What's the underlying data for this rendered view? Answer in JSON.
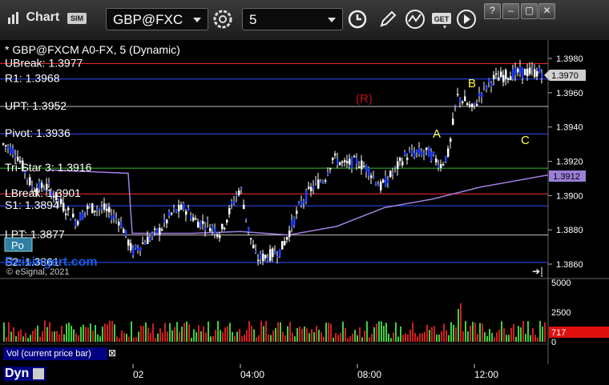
{
  "window": {
    "title": "Chart",
    "sim_badge": "SIM",
    "symbol": "GBP@FXC",
    "interval": "5",
    "buttons": [
      "settings-icon",
      "clock-icon",
      "pencil-icon",
      "study-icon",
      "get-icon",
      "play-icon",
      "help-icon",
      "minimize-icon",
      "restore-icon",
      "close-icon"
    ]
  },
  "chart": {
    "header": "* GBP@FXCM A0-FX, 5 (Dynamic)",
    "watermark": "© eSignal, 2021",
    "site_overlay": "Reisingert.com",
    "pos_badge": "Po",
    "last_price_label": "1.3970",
    "ma_price_label": "1.3912",
    "price_axis_ticks": [
      "1.3980",
      "1.3960",
      "1.3940",
      "1.3920",
      "1.3900",
      "1.3880",
      "1.3860"
    ],
    "levels": [
      {
        "name": "UBreak",
        "label": "UBreak: 1.3977",
        "value": 1.3977,
        "color": "#ff3030"
      },
      {
        "name": "R1",
        "label": "R1: 1.3968",
        "value": 1.3968,
        "color": "#3050ff"
      },
      {
        "name": "UPT",
        "label": "UPT: 1.3952",
        "value": 1.3952,
        "color": "#c0c0c0"
      },
      {
        "name": "Pivot",
        "label": "Pivot: 1.3936",
        "value": 1.3936,
        "color": "#3050ff"
      },
      {
        "name": "Tri-Star 3",
        "label": "Tri-Star 3: 1.3916",
        "value": 1.3916,
        "color": "#30c030"
      },
      {
        "name": "LBreak",
        "label": "LBreak: 1.3901",
        "value": 1.3901,
        "color": "#ff3030"
      },
      {
        "name": "S1",
        "label": "S1: 1.3894",
        "value": 1.3894,
        "color": "#3050ff"
      },
      {
        "name": "LPT",
        "label": "LPT: 1.3877",
        "value": 1.3877,
        "color": "#c0c0c0"
      },
      {
        "name": "S2",
        "label": "S2: 1.3861",
        "value": 1.3861,
        "color": "#3050ff"
      }
    ],
    "annotations": [
      {
        "text": "(R)",
        "color": "#c01010"
      },
      {
        "text": "A",
        "color": "#ffff40"
      },
      {
        "text": "B",
        "color": "#ffff40"
      },
      {
        "text": "C",
        "color": "#ffff40"
      }
    ]
  },
  "volume": {
    "label": "Vol (current price bar)",
    "close_glyph": "⊠",
    "axis_ticks": [
      "5000",
      "2500",
      "0"
    ],
    "current_value": "717"
  },
  "time_axis": {
    "bottom_label": "Dyn",
    "ticks": [
      "02",
      "04:00",
      "08:00",
      "12:00"
    ]
  }
}
